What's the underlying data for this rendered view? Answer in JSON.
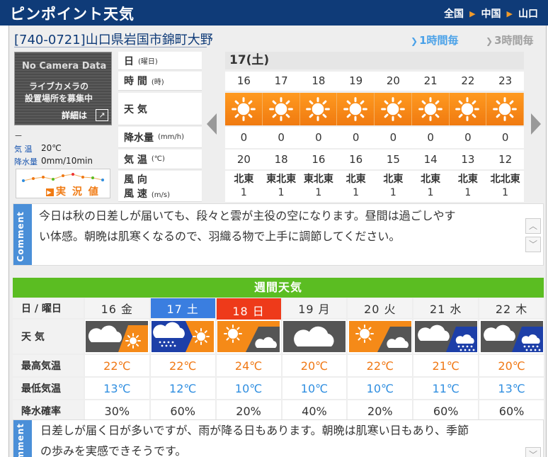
{
  "header": {
    "title": "ピンポイント天気",
    "breadcrumb": [
      "全国",
      "中国",
      "山口"
    ]
  },
  "location": {
    "address": "[740-0721]山口県岩国市錦町大野",
    "mode_1h": "1時間毎",
    "mode_3h": "3時間毎"
  },
  "camera": {
    "line1": "No Camera Data",
    "line2a": "ライブカメラの",
    "line2b": "設置場所を募集中",
    "detail": "詳細は",
    "detail_icon": "external-link-icon"
  },
  "observation": {
    "dash": "－",
    "temp_label": "気 温",
    "temp_value": "20℃",
    "rain_label": "降水量",
    "rain_value": "0mm/10min",
    "button": "実 況 値"
  },
  "hourly": {
    "labels": {
      "date": "日",
      "date_unit": "(曜日)",
      "time": "時 間",
      "time_unit": "(時)",
      "weather": "天 気",
      "rain": "降水量",
      "rain_unit": "(mm/h)",
      "temp": "気 温",
      "temp_unit": "(℃)",
      "wind_dir": "風 向",
      "wind_speed": "風 速",
      "wind_unit": "(m/s)"
    },
    "date": "17(土)",
    "hours": [
      "16",
      "17",
      "18",
      "19",
      "20",
      "21",
      "22",
      "23"
    ],
    "weather": [
      "sunny",
      "sunny",
      "sunny",
      "sunny",
      "sunny",
      "sunny",
      "sunny",
      "sunny"
    ],
    "rain": [
      "0",
      "0",
      "0",
      "0",
      "0",
      "0",
      "0",
      "0"
    ],
    "temp": [
      "20",
      "18",
      "16",
      "16",
      "15",
      "14",
      "13",
      "12"
    ],
    "wind_dir": [
      "北東",
      "東北東",
      "東北東",
      "北東",
      "北東",
      "北東",
      "北東",
      "北北東"
    ],
    "wind_speed": [
      "1",
      "1",
      "1",
      "1",
      "1",
      "1",
      "1",
      "1"
    ]
  },
  "comment1": {
    "tag": "Comment",
    "line1": "今日は秋の日差しが届いても、段々と雲が主役の空になります。昼間は過ごしやす",
    "line2": "い体感。朝晩は肌寒くなるので、羽織る物で上手に調節してください。"
  },
  "weekly": {
    "title": "週間天気",
    "labels": {
      "date": "日 / 曜日",
      "weather": "天 気",
      "hi": "最高気温",
      "lo": "最低気温",
      "pop": "降水確率"
    },
    "days": [
      {
        "date": "16 金",
        "type": "normal",
        "icon": "cloudy-then-sunny",
        "hi": "22℃",
        "lo": "13℃",
        "pop": "30%"
      },
      {
        "date": "17 土",
        "type": "sat",
        "icon": "rain-then-sunny",
        "hi": "22℃",
        "lo": "12℃",
        "pop": "60%"
      },
      {
        "date": "18 日",
        "type": "sun",
        "icon": "sunny-then-cloudy",
        "hi": "24℃",
        "lo": "10℃",
        "pop": "20%"
      },
      {
        "date": "19 月",
        "type": "normal",
        "icon": "cloudy",
        "hi": "20℃",
        "lo": "10℃",
        "pop": "40%"
      },
      {
        "date": "20 火",
        "type": "normal",
        "icon": "sunny-then-cloudy",
        "hi": "22℃",
        "lo": "10℃",
        "pop": "20%"
      },
      {
        "date": "21 水",
        "type": "normal",
        "icon": "cloudy-then-rain",
        "hi": "21℃",
        "lo": "11℃",
        "pop": "60%"
      },
      {
        "date": "22 木",
        "type": "normal",
        "icon": "cloudy-then-rain",
        "hi": "20℃",
        "lo": "13℃",
        "pop": "60%"
      }
    ]
  },
  "comment2": {
    "tag": "Comment",
    "line1": "日差しが届く日が多いですが、雨が降る日もあります。朝晩は肌寒い日もあり、季節",
    "line2": "の歩みを実感できそうです。"
  },
  "colors": {
    "header_bg": "#0f3b78",
    "sunny_orange": "#f58a18",
    "weekly_green": "#5bbd22",
    "saturday_blue": "#3a7ee0",
    "sunday_red": "#ee3a1a",
    "hi_temp": "#f07814",
    "lo_temp": "#2f8ee0"
  }
}
